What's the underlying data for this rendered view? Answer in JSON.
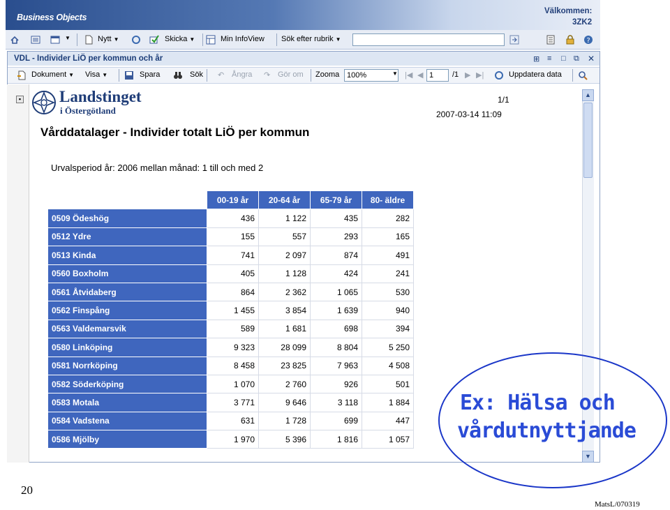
{
  "header": {
    "brand": "Business Objects",
    "welcome": "Välkommen:",
    "username": "3ZK2"
  },
  "main_toolbar": {
    "new_label": "Nytt",
    "send_label": "Skicka",
    "my_infoview_label": "Min InfoView",
    "search_by_label": "Sök efter rubrik",
    "search_value": ""
  },
  "document": {
    "window_title": "VDL - Individer LiÖ per kommun och år",
    "toolbar": {
      "document_label": "Dokument",
      "view_label": "Visa",
      "save_label": "Spara",
      "search_label": "Sök",
      "undo_label": "Ångra",
      "redo_label": "Gör om",
      "zoom_label": "Zooma",
      "zoom_value": "100%",
      "page_value": "1",
      "page_total": "/1",
      "refresh_label": "Uppdatera data"
    }
  },
  "report": {
    "logo_line1": "Landstinget",
    "logo_line2": "i Östergötland",
    "page_indicator": "1/1",
    "datetime": "2007-03-14 11:09",
    "title": "Vårddatalager - Individer totalt LiÖ per kommun",
    "period": "Urvalsperiod år: 2006 mellan månad: 1 till och med 2",
    "columns": [
      "00-19 år",
      "20-64 år",
      "65-79 år",
      "80- äldre"
    ],
    "rows": [
      {
        "label": "0509 Ödeshög",
        "values": [
          "436",
          "1 122",
          "435",
          "282"
        ]
      },
      {
        "label": "0512 Ydre",
        "values": [
          "155",
          "557",
          "293",
          "165"
        ]
      },
      {
        "label": "0513 Kinda",
        "values": [
          "741",
          "2 097",
          "874",
          "491"
        ]
      },
      {
        "label": "0560 Boxholm",
        "values": [
          "405",
          "1 128",
          "424",
          "241"
        ]
      },
      {
        "label": "0561 Åtvidaberg",
        "values": [
          "864",
          "2 362",
          "1 065",
          "530"
        ]
      },
      {
        "label": "0562 Finspång",
        "values": [
          "1 455",
          "3 854",
          "1 639",
          "940"
        ]
      },
      {
        "label": "0563 Valdemarsvik",
        "values": [
          "589",
          "1 681",
          "698",
          "394"
        ]
      },
      {
        "label": "0580 Linköping",
        "values": [
          "9 323",
          "28 099",
          "8 804",
          "5 250"
        ]
      },
      {
        "label": "0581 Norrköping",
        "values": [
          "8 458",
          "23 825",
          "7 963",
          "4 508"
        ]
      },
      {
        "label": "0582 Söderköping",
        "values": [
          "1 070",
          "2 760",
          "926",
          "501"
        ]
      },
      {
        "label": "0583 Motala",
        "values": [
          "3 771",
          "9 646",
          "3 118",
          "1 884"
        ]
      },
      {
        "label": "0584 Vadstena",
        "values": [
          "631",
          "1 728",
          "699",
          "447"
        ]
      },
      {
        "label": "0586 Mjölby",
        "values": [
          "1 970",
          "5 396",
          "1 816",
          "1 057"
        ]
      }
    ]
  },
  "slide": {
    "number": "20",
    "callout_line1": "Ex: Hälsa och",
    "callout_line2": "vårdutnyttjande",
    "footer": "MatsL/070319"
  },
  "colors": {
    "table_header": "#3f66be",
    "header_band": "#2a4e8e",
    "callout": "#2a4bd6"
  },
  "icons": [
    "home-icon",
    "list-icon",
    "layout-icon",
    "new-doc-icon",
    "refresh-icon",
    "send-icon",
    "infoview-icon",
    "go-icon",
    "help-icon",
    "lock-icon",
    "binoculars-icon",
    "magnifier-icon"
  ]
}
